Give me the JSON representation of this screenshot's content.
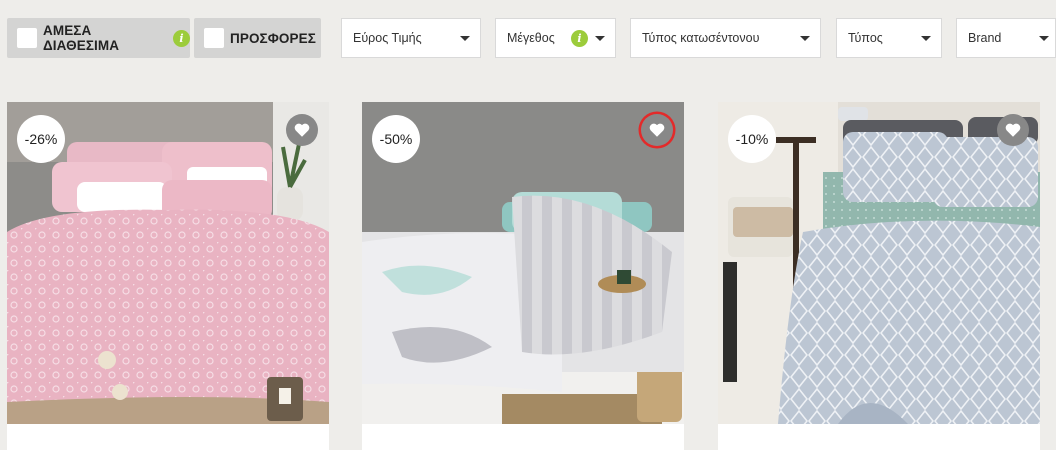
{
  "filters": {
    "available_now": "ΑΜΕΣΑ ΔΙΑΘΕΣΙΜΑ",
    "offers": "ΠΡΟΣΦΟΡΕΣ",
    "info_glyph": "i"
  },
  "dropdowns": {
    "price_range": "Εύρος Τιμής",
    "size": "Μέγεθος",
    "sheet_type": "Τύπος κατωσέντονου",
    "type": "Τύπος",
    "brand": "Brand"
  },
  "products": [
    {
      "discount": "-26%",
      "favorite_active": false,
      "pattern": "pink-paisley"
    },
    {
      "discount": "-50%",
      "favorite_active": true,
      "pattern": "grey-watercolor"
    },
    {
      "discount": "-10%",
      "favorite_active": false,
      "pattern": "blue-diamond"
    }
  ],
  "colors": {
    "page_background": "#eeedea",
    "chip_background": "#d4d4d3",
    "info_green": "#9ccc3b",
    "favorite_ring": "#e32a2a"
  }
}
